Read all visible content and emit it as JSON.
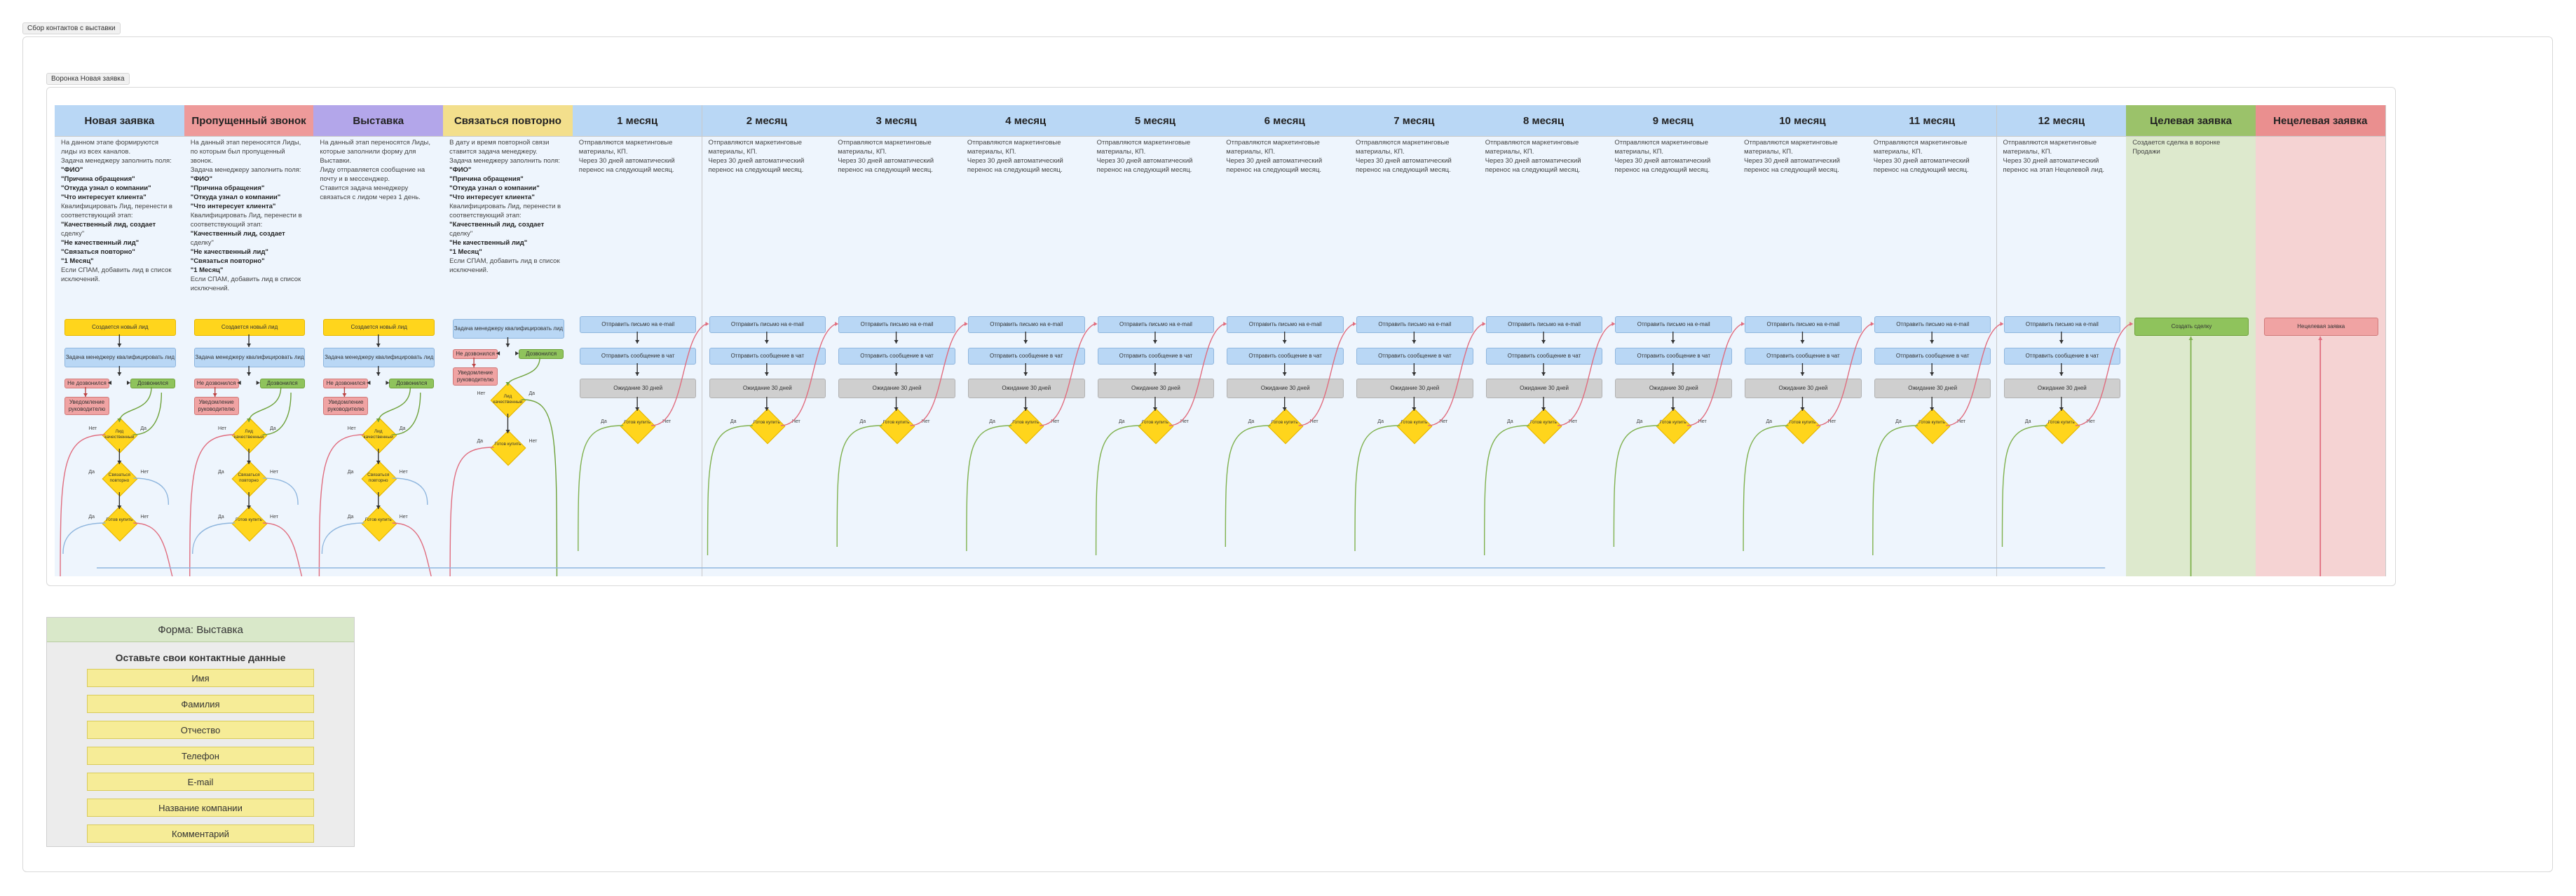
{
  "outer_label": "Сбор контактов с выставки",
  "inner_label": "Воронка Новая заявка",
  "columns": [
    {
      "title": "Новая заявка",
      "color": "#b9d7f5",
      "bg": "#eef5fd",
      "desc": [
        "На данном этапе формируются",
        "лиды из всех каналов.",
        "Задача менеджеру заполнить поля:",
        "\"ФИО\"",
        "\"Причина обращения\"",
        "\"Откуда узнал о компании\"",
        "\"Что интересует клиента\"",
        "Квалифицировать Лид, перенести в",
        "соответствующий этап:",
        "\"Качественный лид, создает",
        "сделку\"",
        "\"Не качественный лид\"",
        "\"Связаться повторно\"",
        "\"1 Месяц\"",
        "Если СПАМ, добавить лид в список",
        "исключений."
      ]
    },
    {
      "title": "Пропущенный звонок",
      "color": "#ee9a9a",
      "bg": "#eef5fd",
      "desc": [
        "На данный этап переносятся Лиды,",
        "по которым был пропущенный",
        "звонок.",
        "Задача менеджеру заполнить поля:",
        "\"ФИО\"",
        "\"Причина обращения\"",
        "\"Откуда узнал о компании\"",
        "\"Что интересует клиента\"",
        "Квалифицировать Лид, перенести в",
        "соответствующий этап:",
        "\"Качественный лид, создает",
        "сделку\"",
        "\"Не качественный лид\"",
        "\"Связаться повторно\"",
        "\"1 Месяц\"",
        "Если СПАМ, добавить лид в список",
        "исключений."
      ]
    },
    {
      "title": "Выставка",
      "color": "#b3a6ea",
      "bg": "#eef5fd",
      "desc": [
        "На данный этап переносятся Лиды,",
        "которые заполнили форму для",
        "Выставки.",
        "Лиду отправляется сообщение на",
        "почту и в мессенджер.",
        "Ставится задача менеджеру",
        "связаться с лидом через 1 день."
      ]
    },
    {
      "title": "Связаться повторно",
      "color": "#f3df8c",
      "bg": "#eef5fd",
      "desc": [
        "В дату и время повторной связи",
        "ставится задача менеджеру.",
        "Задача менеджеру заполнить поля:",
        "\"ФИО\"",
        "\"Причина обращения\"",
        "\"Откуда узнал о компании\"",
        "\"Что интересует клиента\"",
        "Квалифицировать Лид, перенести в",
        "соответствующий этап:",
        "\"Качественный лид, создает",
        "сделку\"",
        "\"Не качественный лид\"",
        "\"1 Месяц\"",
        "Если СПАМ, добавить лид в список",
        "исключений."
      ]
    },
    {
      "title": "1 месяц",
      "color": "#b9d7f5",
      "bg": "#eef5fd",
      "desc": [
        "Отправляются маркетинговые",
        "материалы, КП.",
        "Через 30 дней автоматический",
        "перенос на следующий месяц."
      ]
    },
    {
      "title": "2 месяц",
      "color": "#b9d7f5",
      "bg": "#eef5fd",
      "desc": [
        "Отправляются маркетинговые",
        "материалы, КП.",
        "Через 30 дней автоматический",
        "перенос на следующий месяц."
      ]
    },
    {
      "title": "3 месяц",
      "color": "#b9d7f5",
      "bg": "#eef5fd",
      "desc": [
        "Отправляются маркетинговые",
        "материалы, КП.",
        "Через 30 дней автоматический",
        "перенос на следующий месяц."
      ]
    },
    {
      "title": "4 месяц",
      "color": "#b9d7f5",
      "bg": "#eef5fd",
      "desc": [
        "Отправляются маркетинговые",
        "материалы, КП.",
        "Через 30 дней автоматический",
        "перенос на следующий месяц."
      ]
    },
    {
      "title": "5 месяц",
      "color": "#b9d7f5",
      "bg": "#eef5fd",
      "desc": [
        "Отправляются маркетинговые",
        "материалы, КП.",
        "Через 30 дней автоматический",
        "перенос на следующий месяц."
      ]
    },
    {
      "title": "6 месяц",
      "color": "#b9d7f5",
      "bg": "#eef5fd",
      "desc": [
        "Отправляются маркетинговые",
        "материалы, КП.",
        "Через 30 дней автоматический",
        "перенос на следующий месяц."
      ]
    },
    {
      "title": "7 месяц",
      "color": "#b9d7f5",
      "bg": "#eef5fd",
      "desc": [
        "Отправляются маркетинговые",
        "материалы, КП.",
        "Через 30 дней автоматический",
        "перенос на следующий месяц."
      ]
    },
    {
      "title": "8 месяц",
      "color": "#b9d7f5",
      "bg": "#eef5fd",
      "desc": [
        "Отправляются маркетинговые",
        "материалы, КП.",
        "Через 30 дней автоматический",
        "перенос на следующий месяц."
      ]
    },
    {
      "title": "9 месяц",
      "color": "#b9d7f5",
      "bg": "#eef5fd",
      "desc": [
        "Отправляются маркетинговые",
        "материалы, КП.",
        "Через 30 дней автоматический",
        "перенос на следующий месяц."
      ]
    },
    {
      "title": "10 месяц",
      "color": "#b9d7f5",
      "bg": "#eef5fd",
      "desc": [
        "Отправляются маркетинговые",
        "материалы, КП.",
        "Через 30 дней автоматический",
        "перенос на следующий месяц."
      ]
    },
    {
      "title": "11 месяц",
      "color": "#b9d7f5",
      "bg": "#eef5fd",
      "desc": [
        "Отправляются маркетинговые",
        "материалы, КП.",
        "Через 30 дней автоматический",
        "перенос на следующий месяц."
      ]
    },
    {
      "title": "12 месяц",
      "color": "#b9d7f5",
      "bg": "#eef5fd",
      "desc": [
        "Отправляются маркетинговые",
        "материалы, КП.",
        "Через 30 дней автоматический",
        "перенос на этап Нецелевой лид."
      ]
    },
    {
      "title": "Целевая заявка",
      "color": "#9bc26a",
      "bg": "#dde9cd",
      "desc": [
        "Создается сделка в воронке",
        "Продажи"
      ]
    },
    {
      "title": "Нецелевая заявка",
      "color": "#ea8f8f",
      "bg": "#f5d3d3",
      "desc": []
    }
  ],
  "flow": {
    "create_lead": "Создается новый лид",
    "manager_task": "Задача менеджеру квалифицировать лид",
    "not_answered": "Не дозвонился",
    "answered": "Дозвонился",
    "notify": "Уведомление руководителю",
    "q_quality": "Лид качественный",
    "q_callback": "Связаться повторно",
    "q_month": "Готов купить",
    "email": "Отправить письмо на e-mail",
    "messenger": "Отправить сообщение в чат",
    "wait": "Ожидание 30 дней",
    "q_ready": "Готов купить",
    "yes": "Да",
    "no": "Нет",
    "create_deal": "Создать сделку",
    "not_target": "Нецелевая заявка"
  },
  "form": {
    "title": "Форма: Выставка",
    "subtitle": "Оставьте свои контактные данные",
    "fields": [
      "Имя",
      "Фамилия",
      "Отчество",
      "Телефон",
      "E-mail",
      "Название компании",
      "Комментарий"
    ]
  }
}
